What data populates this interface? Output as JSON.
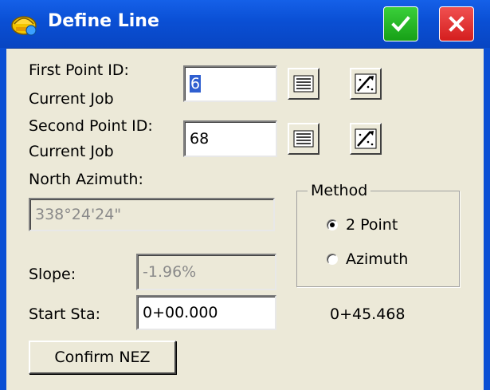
{
  "window": {
    "title": "Define Line"
  },
  "first_point": {
    "label_line1": "First Point ID:",
    "label_line2": "Current Job",
    "value": "6"
  },
  "second_point": {
    "label_line1": "Second Point ID:",
    "label_line2": "Current Job",
    "value": "68"
  },
  "azimuth": {
    "label": "North Azimuth:",
    "value": "338°24'24\""
  },
  "slope": {
    "label": "Slope:",
    "value": "-1.96%"
  },
  "start_sta": {
    "label": "Start Sta:",
    "value": "0+00.000"
  },
  "end_sta": {
    "value": "0+45.468"
  },
  "method": {
    "title": "Method",
    "options": [
      {
        "label": "2 Point",
        "selected": true
      },
      {
        "label": "Azimuth",
        "selected": false
      }
    ]
  },
  "confirm_button": {
    "label": "Confirm NEZ"
  },
  "colors": {
    "titlebar": "#0a4fd4",
    "ok": "#17a017",
    "close": "#d41e1e",
    "dialog_bg": "#ece9d8"
  },
  "icons": [
    "helmet-app-icon",
    "checkmark-icon",
    "close-x-icon",
    "list-icon",
    "map-pick-icon"
  ]
}
